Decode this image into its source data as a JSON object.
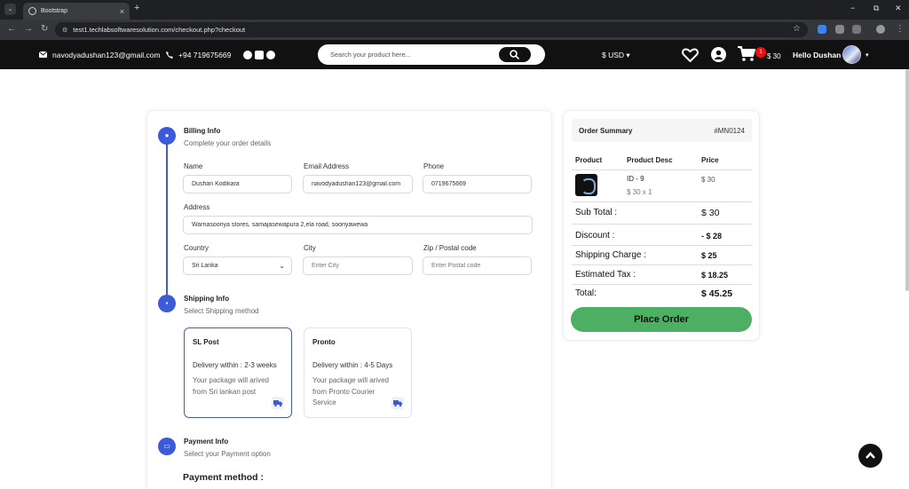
{
  "browser": {
    "tab_title": "Bootstrap",
    "url": "test1.techlabsoftwaresolution.com/checkout.php?checkout"
  },
  "header": {
    "email": "navodyadushan123@gmail.com",
    "phone": "+94 719675669",
    "search_placeholder": "Search your product here...",
    "currency": "$ USD",
    "cart_count": "1",
    "cart_total": "$ 30",
    "greeting": "Hello Dushan"
  },
  "billing": {
    "title": "Billing Info",
    "subtitle": "Complete your order details",
    "name_label": "Name",
    "name_value": "Dushan Kodikara",
    "email_label": "Email Address",
    "email_value": "navodyadushan123@gmail.com",
    "phone_label": "Phone",
    "phone_value": "0719675669",
    "address_label": "Address",
    "address_value": "Warnasooriya stores, samajasewapura 2,ela road, sooriyawewa",
    "country_label": "Country",
    "country_value": "Sri Lanka",
    "city_label": "City",
    "city_placeholder": "Enter City",
    "zip_label": "Zip / Postal code",
    "zip_placeholder": "Enter Postal code"
  },
  "shipping": {
    "title": "Shipping Info",
    "subtitle": "Select Shipping method",
    "options": [
      {
        "name": "SL Post",
        "delivery": "Delivery within : 2-3 weeks",
        "desc": "Your package will arived from Sri lankan post",
        "selected": true
      },
      {
        "name": "Pronto",
        "delivery": "Delivery within : 4-5 Days",
        "desc": "Your package will arived from Pronto Courier Service",
        "selected": false
      }
    ]
  },
  "payment": {
    "title": "Payment Info",
    "subtitle": "Select your Payment option",
    "method_label": "Payment method :"
  },
  "summary": {
    "title": "Order Summary",
    "order_id": "#MN0124",
    "col_product": "Product",
    "col_desc": "Product Desc",
    "col_price": "Price",
    "item_id": "ID - 9",
    "item_qty": "$ 30 x 1",
    "item_price": "$ 30",
    "rows": [
      {
        "label": "Sub Total :",
        "value": "$ 30"
      },
      {
        "label": "Discount :",
        "value": "- $ 28"
      },
      {
        "label": "Shipping Charge :",
        "value": "$ 25"
      },
      {
        "label": "Estimated Tax :",
        "value": "$ 18.25"
      },
      {
        "label": "Total:",
        "value": "$ 45.25"
      }
    ],
    "place_order": "Place Order"
  },
  "colors": {
    "accent": "#3b5bdb",
    "place_order": "#4caf62",
    "header_bg": "#111111",
    "badge": "#e11111"
  }
}
